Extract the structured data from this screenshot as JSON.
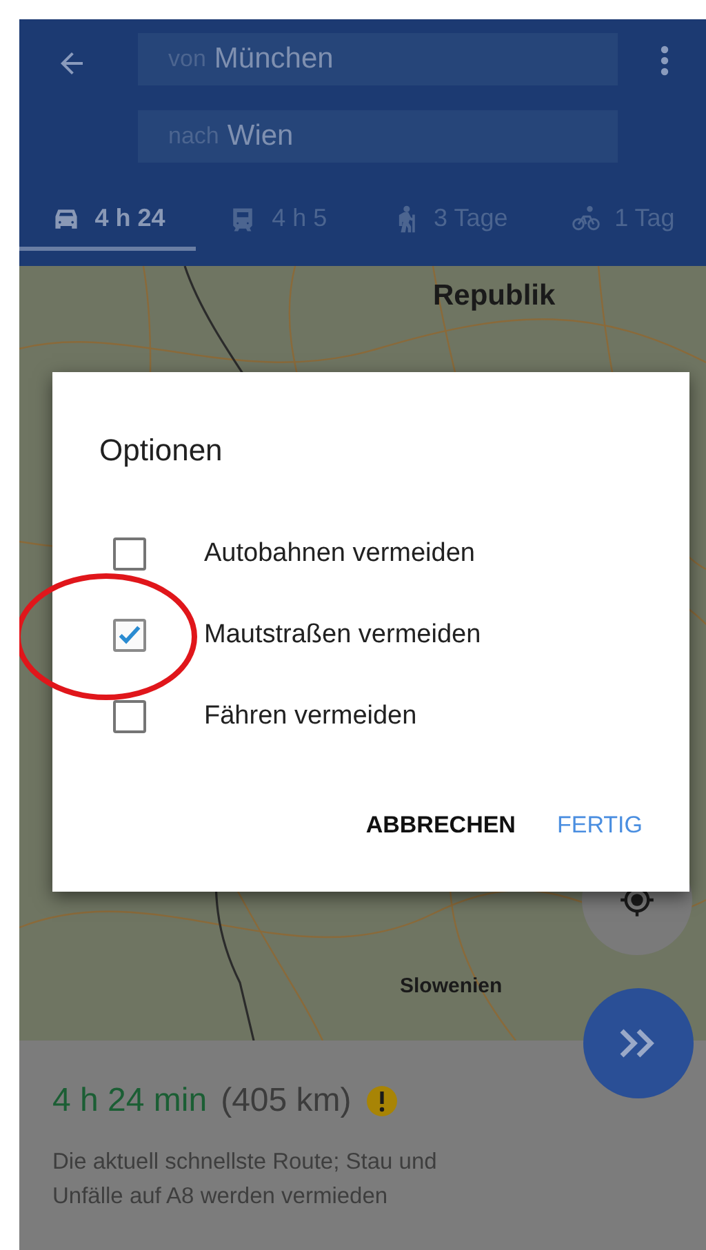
{
  "header": {
    "from": {
      "prefix": "von",
      "value": "München"
    },
    "to": {
      "prefix": "nach",
      "value": "Wien"
    }
  },
  "modes": [
    {
      "kind": "car",
      "label": "4 h 24",
      "selected": true
    },
    {
      "kind": "train",
      "label": "4 h 5",
      "selected": false
    },
    {
      "kind": "walk",
      "label": "3 Tage",
      "selected": false
    },
    {
      "kind": "bike",
      "label": "1 Tag",
      "selected": false
    }
  ],
  "map": {
    "labels": [
      "Republik",
      "Slowenien"
    ]
  },
  "dialog": {
    "title": "Optionen",
    "options": [
      {
        "label": "Autobahnen vermeiden",
        "checked": false
      },
      {
        "label": "Mautstraßen vermeiden",
        "checked": true
      },
      {
        "label": "Fähren vermeiden",
        "checked": false
      }
    ],
    "buttons": [
      {
        "kind": "cancel",
        "label": "ABBRECHEN"
      },
      {
        "kind": "confirm",
        "label": "FERTIG"
      }
    ]
  },
  "route": {
    "duration": "4 h 24 min",
    "distance": "(405 km)",
    "warning": true,
    "description": "Die aktuell schnellste Route; Stau und Unfälle auf A8 werden vermieden"
  }
}
